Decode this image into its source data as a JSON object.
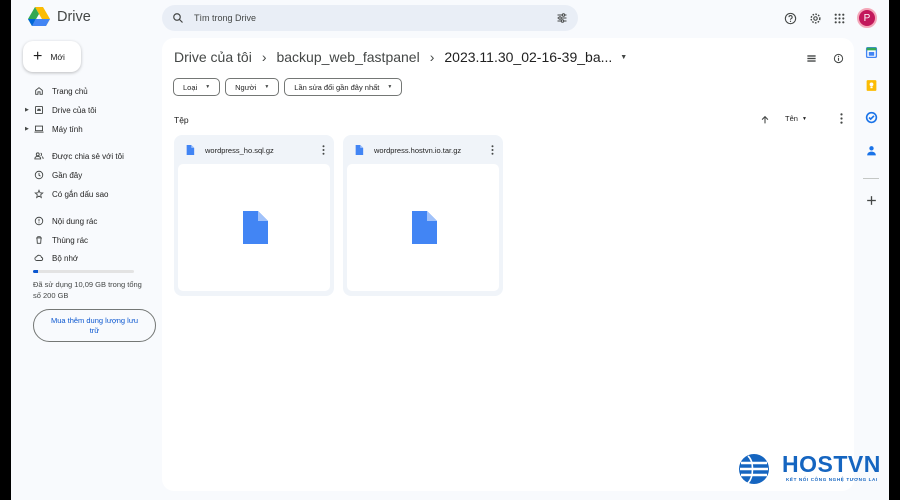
{
  "app": {
    "name": "Drive"
  },
  "search": {
    "placeholder": "Tìm trong Drive"
  },
  "header": {
    "avatar_letter": "P"
  },
  "sidebar": {
    "new_label": "Mới",
    "items": [
      {
        "label": "Trang chủ",
        "icon": "home-icon"
      },
      {
        "label": "Drive của tôi",
        "icon": "my-drive-icon"
      },
      {
        "label": "Máy tính",
        "icon": "computer-icon"
      },
      {
        "label": "Được chia sẻ với tôi",
        "icon": "shared-icon"
      },
      {
        "label": "Gần đây",
        "icon": "clock-icon"
      },
      {
        "label": "Có gắn dấu sao",
        "icon": "star-icon"
      },
      {
        "label": "Nội dung rác",
        "icon": "spam-icon"
      },
      {
        "label": "Thùng rác",
        "icon": "trash-icon"
      },
      {
        "label": "Bộ nhớ",
        "icon": "cloud-icon"
      }
    ],
    "storage": {
      "used_fraction": 0.05,
      "text": "Đã sử dụng 10,09 GB trong tổng số 200 GB"
    },
    "buy_storage_label": "Mua thêm dung lượng lưu trữ"
  },
  "breadcrumb": {
    "items": [
      "Drive của tôi",
      "backup_web_fastpanel",
      "2023.11.30_02-16-39_ba..."
    ]
  },
  "filters": {
    "type": "Loại",
    "people": "Người",
    "modified": "Lần sửa đổi gần đây nhất"
  },
  "files_section": {
    "title": "Tệp",
    "sort_label": "Tên",
    "files": [
      {
        "name": "wordpress_ho.sql.gz"
      },
      {
        "name": "wordpress.hostvn.io.tar.gz"
      }
    ]
  },
  "colors": {
    "accent": "#0b57d0",
    "file_icon": "#4285f4",
    "background": "#f8fafd"
  },
  "watermark": {
    "brand": "HOSTVN",
    "tagline": "KẾT NỐI CÔNG NGHỆ TƯƠNG LAI"
  }
}
